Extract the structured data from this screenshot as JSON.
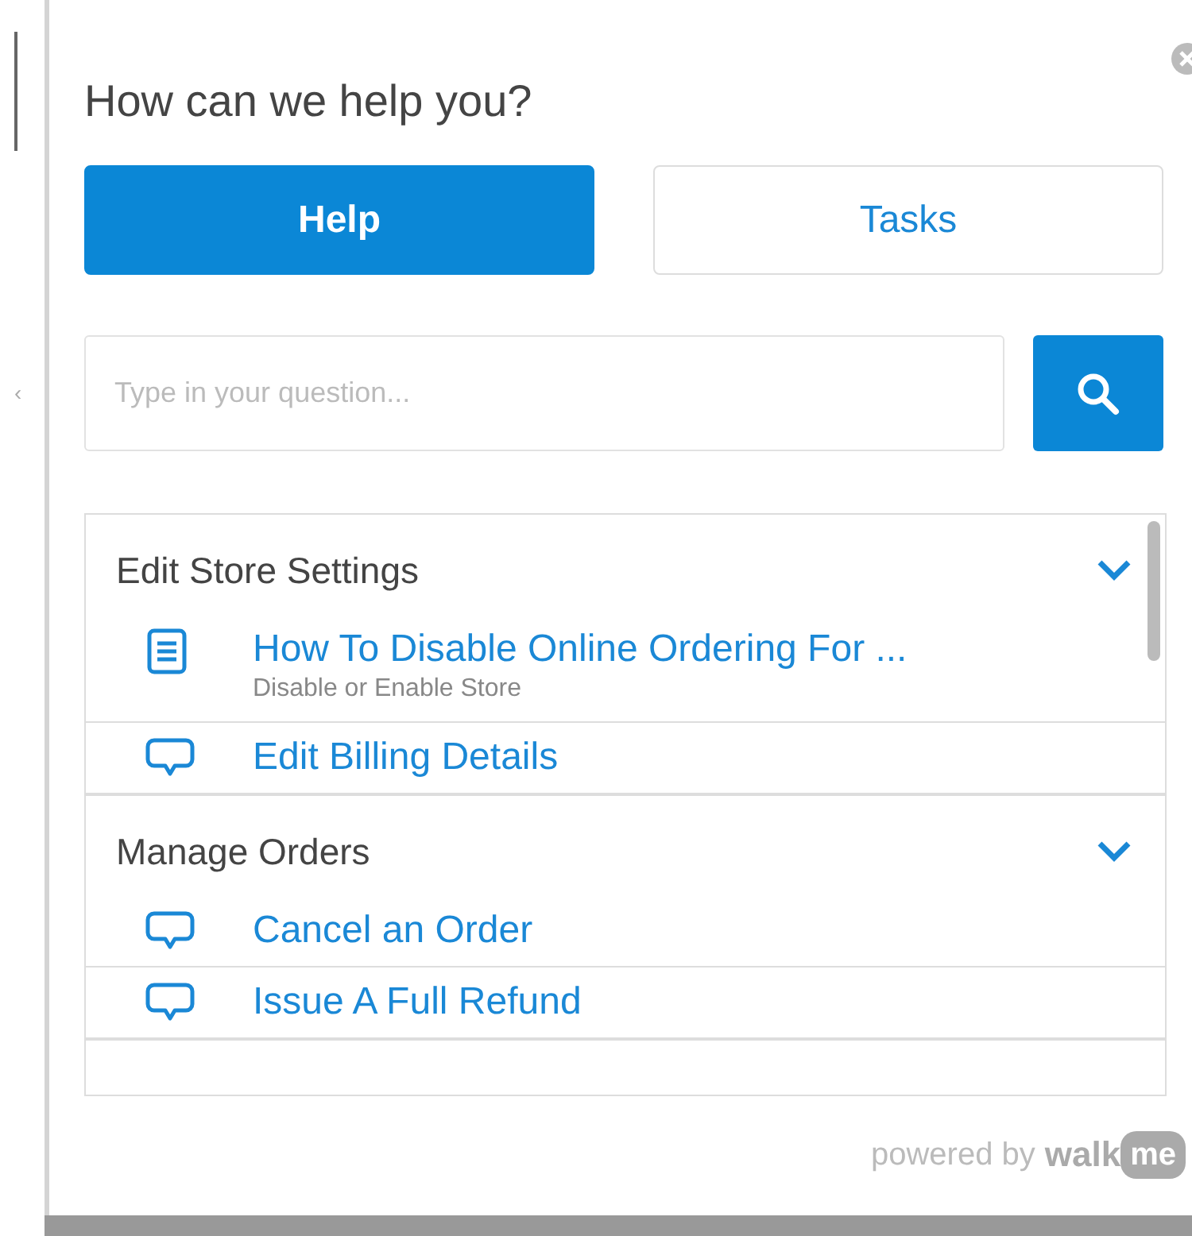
{
  "side_arrow": "‹",
  "title": "How can we help you?",
  "tabs": [
    {
      "label": "Help",
      "selected": true
    },
    {
      "label": "Tasks",
      "selected": false
    }
  ],
  "search": {
    "placeholder": "Type in your question..."
  },
  "groups": [
    {
      "title": "Edit Store Settings",
      "expanded": true,
      "items": [
        {
          "kind": "article",
          "label": "How To Disable Online Ordering For ...",
          "subtitle": "Disable or Enable Store"
        },
        {
          "kind": "chat",
          "label": "Edit Billing Details"
        }
      ]
    },
    {
      "title": "Manage Orders",
      "expanded": true,
      "items": [
        {
          "kind": "chat",
          "label": "Cancel an Order"
        },
        {
          "kind": "chat",
          "label": "Issue A Full Refund"
        }
      ]
    }
  ],
  "footer": {
    "text": "powered by",
    "brand": "walk",
    "badge": "me"
  }
}
